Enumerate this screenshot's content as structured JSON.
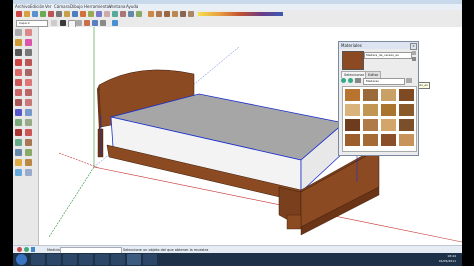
{
  "window": {
    "title": ""
  },
  "menu": {
    "items": [
      "Archivo",
      "Edición",
      "Ver",
      "Cámara",
      "Dibujo",
      "Herramientas",
      "Ventana",
      "Ayuda"
    ]
  },
  "toolbar": {
    "layer_value": "Capa 0"
  },
  "materials": {
    "title": "Materiales",
    "material_name": "Madera_de_cerezo_en",
    "tabs": [
      "Seleccionar",
      "Editar"
    ],
    "collection": "Maderas",
    "swatches": [
      {
        "color": "#b8742f"
      },
      {
        "color": "#9a6a3a"
      },
      {
        "color": "#c9a066"
      },
      {
        "color": "#7e4a24"
      },
      {
        "color": "#d9b27c"
      },
      {
        "color": "#c19552"
      },
      {
        "color": "#a8742e"
      },
      {
        "color": "#8a5a2b"
      },
      {
        "color": "#6e3b1c"
      },
      {
        "color": "#b07a48"
      },
      {
        "color": "#d4a56b"
      },
      {
        "color": "#7a4f2a"
      },
      {
        "color": "#9b5e2c"
      },
      {
        "color": "#a46b35"
      },
      {
        "color": "#8a4e28"
      },
      {
        "color": "#c8935a"
      }
    ],
    "tooltip": "Madera_de_cerezo_en"
  },
  "status": {
    "message": "Seleccione un objeto del que obtener la muestra",
    "measurements_label": "Medidas"
  },
  "clock": {
    "time": "18:44",
    "date": "01/05/2011"
  },
  "colors": {
    "bed_wood": "#8b4a22",
    "bed_wood_dark": "#6b3417",
    "mattress_top": "#a6a6a6",
    "mattress_side": "#f3f3f3",
    "edge_blue": "#1a2fd0"
  }
}
